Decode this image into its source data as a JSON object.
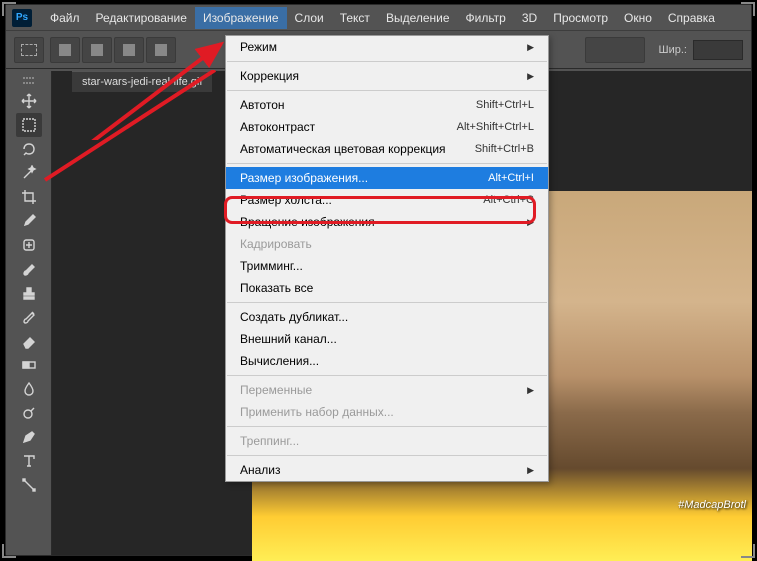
{
  "logo": "Ps",
  "menubar": [
    "Файл",
    "Редактирование",
    "Изображение",
    "Слои",
    "Текст",
    "Выделение",
    "Фильтр",
    "3D",
    "Просмотр",
    "Окно",
    "Справка"
  ],
  "active_menu_index": 2,
  "toolbar": {
    "width_label": "Шир.:"
  },
  "doc_tab": "star-wars-jedi-real-life.gif",
  "watermark": "#MadcapBrotl",
  "dropdown": [
    {
      "type": "item",
      "label": "Режим",
      "submenu": true
    },
    {
      "type": "sep"
    },
    {
      "type": "item",
      "label": "Коррекция",
      "submenu": true
    },
    {
      "type": "sep"
    },
    {
      "type": "item",
      "label": "Автотон",
      "shortcut": "Shift+Ctrl+L"
    },
    {
      "type": "item",
      "label": "Автоконтраст",
      "shortcut": "Alt+Shift+Ctrl+L"
    },
    {
      "type": "item",
      "label": "Автоматическая цветовая коррекция",
      "shortcut": "Shift+Ctrl+B"
    },
    {
      "type": "sep"
    },
    {
      "type": "item",
      "label": "Размер изображения...",
      "shortcut": "Alt+Ctrl+I",
      "highlight": true
    },
    {
      "type": "item",
      "label": "Размер холста...",
      "shortcut": "Alt+Ctrl+C"
    },
    {
      "type": "item",
      "label": "Вращение изображения",
      "submenu": true
    },
    {
      "type": "item",
      "label": "Кадрировать",
      "disabled": true
    },
    {
      "type": "item",
      "label": "Тримминг..."
    },
    {
      "type": "item",
      "label": "Показать все"
    },
    {
      "type": "sep"
    },
    {
      "type": "item",
      "label": "Создать дубликат..."
    },
    {
      "type": "item",
      "label": "Внешний канал..."
    },
    {
      "type": "item",
      "label": "Вычисления..."
    },
    {
      "type": "sep"
    },
    {
      "type": "item",
      "label": "Переменные",
      "submenu": true,
      "disabled": true
    },
    {
      "type": "item",
      "label": "Применить набор данных...",
      "disabled": true
    },
    {
      "type": "sep"
    },
    {
      "type": "item",
      "label": "Треппинг...",
      "disabled": true
    },
    {
      "type": "sep"
    },
    {
      "type": "item",
      "label": "Анализ",
      "submenu": true
    }
  ],
  "tools": [
    {
      "name": "move-tool",
      "glyph": "move"
    },
    {
      "name": "marquee-tool",
      "glyph": "marquee",
      "selected": true
    },
    {
      "name": "lasso-tool",
      "glyph": "lasso"
    },
    {
      "name": "wand-tool",
      "glyph": "wand"
    },
    {
      "name": "crop-tool",
      "glyph": "crop"
    },
    {
      "name": "eyedropper-tool",
      "glyph": "eyedropper"
    },
    {
      "name": "heal-tool",
      "glyph": "heal"
    },
    {
      "name": "brush-tool",
      "glyph": "brush"
    },
    {
      "name": "stamp-tool",
      "glyph": "stamp"
    },
    {
      "name": "history-brush-tool",
      "glyph": "history"
    },
    {
      "name": "eraser-tool",
      "glyph": "eraser"
    },
    {
      "name": "gradient-tool",
      "glyph": "gradient"
    },
    {
      "name": "blur-tool",
      "glyph": "blur"
    },
    {
      "name": "dodge-tool",
      "glyph": "dodge"
    },
    {
      "name": "pen-tool",
      "glyph": "pen"
    },
    {
      "name": "type-tool",
      "glyph": "type"
    },
    {
      "name": "path-select-tool",
      "glyph": "path"
    }
  ]
}
